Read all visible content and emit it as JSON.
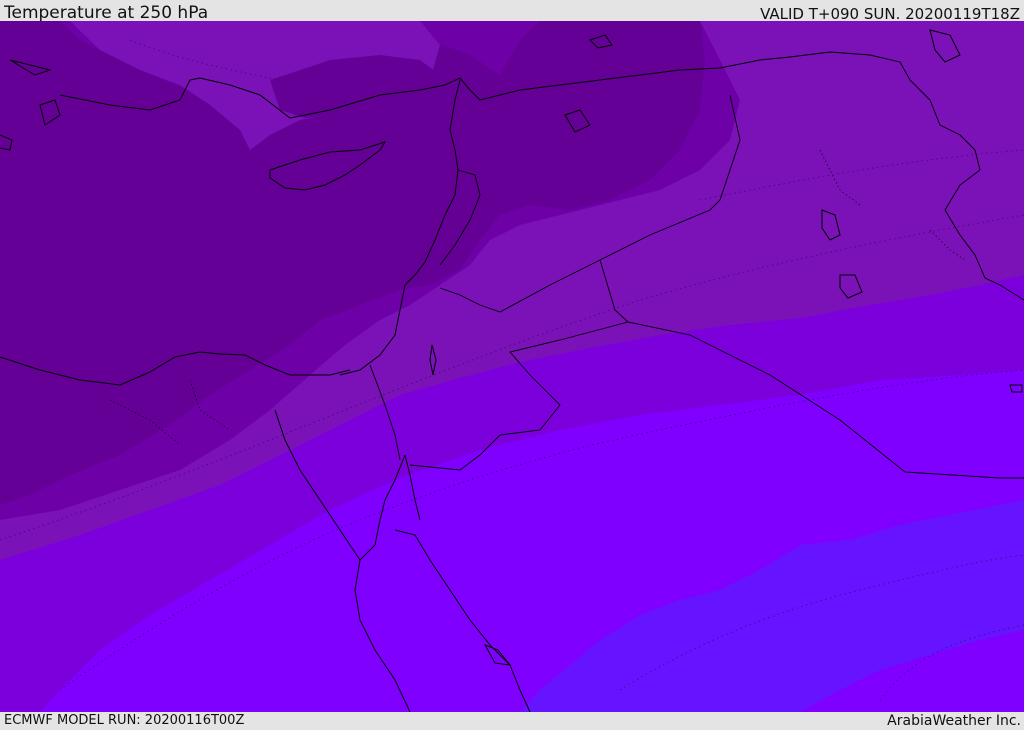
{
  "header": {
    "title": "Temperature at 250 hPa",
    "valid": "VALID T+090 SUN. 20200119T18Z"
  },
  "footer": {
    "model_run": "ECMWF MODEL RUN: 20200116T00Z",
    "credit": "ArabiaWeather Inc."
  },
  "map": {
    "variable": "temperature",
    "level": "250 hPa",
    "region": "Eastern Mediterranean / Middle East",
    "colors": {
      "coldest": "#640096",
      "cold": "#6e00a8",
      "mid_cold": "#7a12b8",
      "mid": "#7c00dc",
      "warm": "#8000ff",
      "warmest": "#6614ff",
      "coastline": "#000000"
    }
  }
}
